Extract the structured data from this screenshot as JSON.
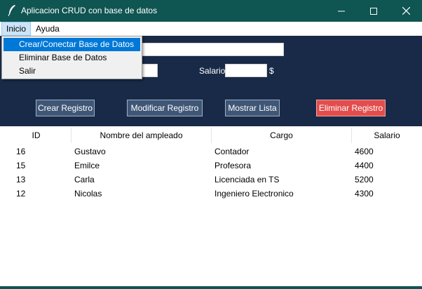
{
  "window": {
    "title": "Aplicacion CRUD con base de datos",
    "icon": "feather-icon"
  },
  "menubar": {
    "items": [
      {
        "label": "Inicio",
        "active": true
      },
      {
        "label": "Ayuda",
        "active": false
      }
    ]
  },
  "dropdown": {
    "items": [
      {
        "label": "Crear/Conectar Base de Datos",
        "selected": true
      },
      {
        "label": "Eliminar Base de Datos",
        "selected": false
      },
      {
        "label": "Salir",
        "selected": false
      }
    ]
  },
  "form": {
    "nombre_value": "",
    "cargo_value": "",
    "salario_label": "Salario",
    "salario_value": "",
    "currency_symbol": "$"
  },
  "buttons": {
    "crear": "Crear Registro",
    "modificar": "Modificar Registro",
    "mostrar": "Mostrar Lista",
    "eliminar": "Eliminar Registro"
  },
  "table": {
    "columns": [
      "ID",
      "Nombre del ampleado",
      "Cargo",
      "Salario"
    ],
    "rows": [
      [
        "16",
        "Gustavo",
        "Contador",
        "4600"
      ],
      [
        "15",
        "Emilce",
        "Profesora",
        "4400"
      ],
      [
        "13",
        "Carla",
        "Licenciada en TS",
        "5200"
      ],
      [
        "12",
        "Nicolas",
        "Ingeniero Electronico",
        "4300"
      ]
    ]
  },
  "colors": {
    "titlebar": "#0f5552",
    "form_background": "#182a47",
    "button_background": "#3f5676",
    "delete_button": "#e24d4d",
    "menu_selection": "#0078d7"
  }
}
